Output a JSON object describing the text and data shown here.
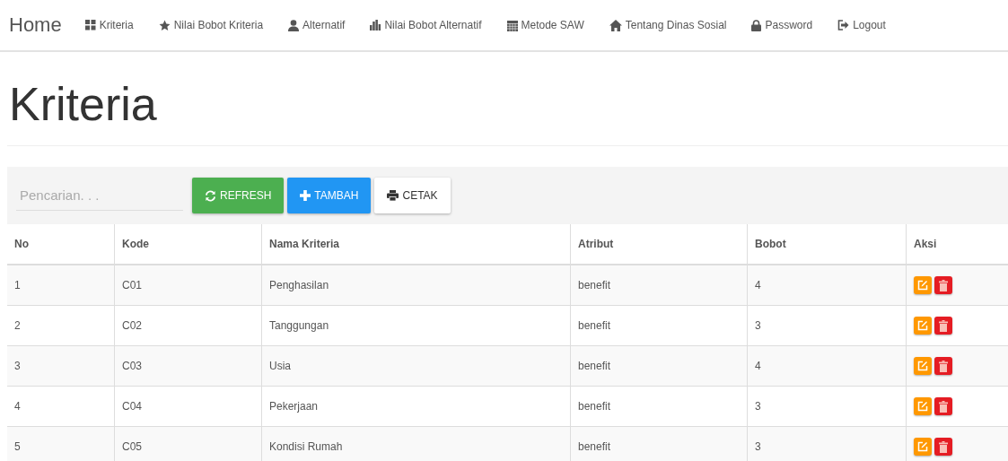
{
  "nav": {
    "brand": "Home",
    "items": [
      {
        "kind": "grid",
        "label": "Kriteria"
      },
      {
        "kind": "star",
        "label": "Nilai Bobot Kriteria"
      },
      {
        "kind": "user",
        "label": "Alternatif"
      },
      {
        "kind": "bars",
        "label": "Nilai Bobot Alternatif"
      },
      {
        "kind": "calendar",
        "label": "Metode SAW"
      },
      {
        "kind": "home",
        "label": "Tentang Dinas Sosial"
      },
      {
        "kind": "lock",
        "label": "Password"
      },
      {
        "kind": "logout",
        "label": "Logout"
      }
    ]
  },
  "page_title": "Kriteria",
  "toolbar": {
    "search": {
      "placeholder": "Pencarian. . ."
    },
    "buttons": [
      {
        "kind": "refresh",
        "label": "REFRESH"
      },
      {
        "kind": "add",
        "label": "TAMBAH"
      },
      {
        "kind": "print",
        "label": "CETAK"
      }
    ]
  },
  "table": {
    "columns": [
      "No",
      "Kode",
      "Nama Kriteria",
      "Atribut",
      "Bobot",
      "Aksi"
    ],
    "rows": [
      {
        "cells": [
          "1",
          "C01",
          "Penghasilan",
          "benefit",
          "4"
        ]
      },
      {
        "cells": [
          "2",
          "C02",
          "Tanggungan",
          "benefit",
          "3"
        ]
      },
      {
        "cells": [
          "3",
          "C03",
          "Usia",
          "benefit",
          "4"
        ]
      },
      {
        "cells": [
          "4",
          "C04",
          "Pekerjaan",
          "benefit",
          "3"
        ]
      },
      {
        "cells": [
          "5",
          "C05",
          "Kondisi Rumah",
          "benefit",
          "3"
        ]
      }
    ]
  }
}
